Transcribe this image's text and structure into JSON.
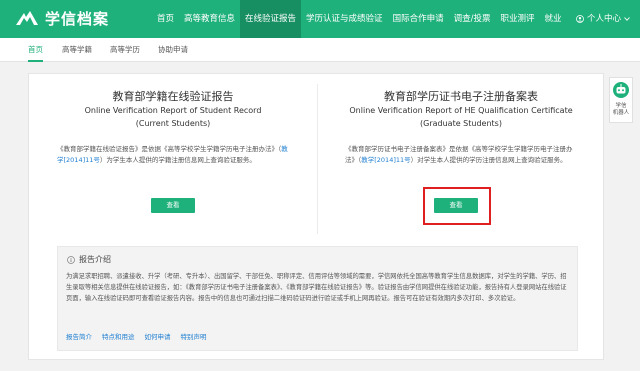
{
  "header": {
    "logo_text": "学信档案",
    "nav": [
      {
        "label": "首页"
      },
      {
        "label": "高等教育信息"
      },
      {
        "label": "在线验证报告"
      },
      {
        "label": "学历认证与成绩验证"
      },
      {
        "label": "国际合作申请"
      },
      {
        "label": "调查/投票"
      },
      {
        "label": "职业测评"
      },
      {
        "label": "就业"
      }
    ],
    "active_nav": "在线验证报告",
    "user_label": "个人中心"
  },
  "subnav": {
    "items": [
      {
        "label": "首页"
      },
      {
        "label": "高等学籍"
      },
      {
        "label": "高等学历"
      },
      {
        "label": "协助申请"
      }
    ],
    "active": "首页"
  },
  "left_card": {
    "title_cn": "教育部学籍在线验证报告",
    "title_en_1": "Online Verification Report of Student Record",
    "title_en_2": "(Current Students)",
    "desc_1": "《教育部学籍在线验证报告》是依据《高等学校学生学籍学历电子注册办法》（",
    "desc_link": "教学[2014]11号",
    "desc_2": "）为学生本人提供的学籍注册信息网上查询验证服务。",
    "button": "查看"
  },
  "right_card": {
    "title_cn": "教育部学历证书电子注册备案表",
    "title_en_1": "Online Verification Report of HE Qualification Certificate",
    "title_en_2": "(Graduate Students)",
    "desc_1": "《教育部学历证书电子注册备案表》是依据《高等学校学生学籍学历电子注册办法》（",
    "desc_link": "教学[2014]11号",
    "desc_2": "）对学生本人提供的学历注册信息网上查询验证服务。",
    "button": "查看"
  },
  "intro": {
    "title": "报告介绍",
    "body": "为满足求职招聘、派遣接收、升学（考研、专升本）、出国留学、干部任免、职称评定、信用评估等领域的需要，学信网依托全国高等教育学生信息数据库，对学生的学籍、学历、招生录取等相关信息提供在线验证报告，如：《教育部学历证书电子注册备案表》、《教育部学籍在线验证报告》等。验证报告由学信网提供在线验证功能，报告持有人登录网站在线验证页面，输入在线验证码即可查看验证报告内容。报告中的信息也可通过扫描二维码验证码进行验证或手机上网再验证。报告可在验证有效期内多次打印、多次验证。",
    "links": [
      {
        "label": "报告简介"
      },
      {
        "label": "特点和用途"
      },
      {
        "label": "如何申请"
      },
      {
        "label": "特别声明"
      }
    ]
  },
  "robot": {
    "label_1": "学信",
    "label_2": "机器人"
  },
  "colors": {
    "brand_green": "#1fb17c",
    "active_nav": "#178f63",
    "link_blue": "#1f7fd0",
    "highlight_red": "#e02020"
  }
}
